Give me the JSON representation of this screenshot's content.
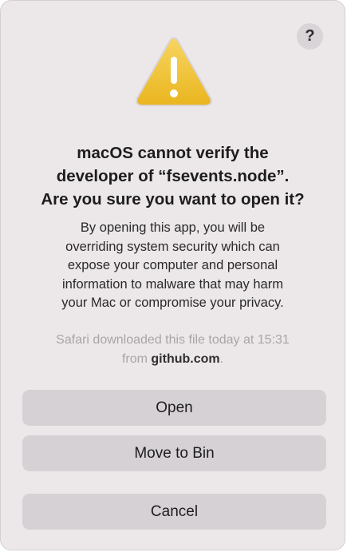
{
  "help": {
    "label": "?"
  },
  "icon": {
    "name": "warning-icon",
    "fill_color": "#f2c12e",
    "mark": "!"
  },
  "title": {
    "lines": [
      "macOS cannot verify the",
      "developer of “fsevents.node”.",
      "Are you sure you want to open it?"
    ]
  },
  "message": {
    "lines": [
      "By opening this app, you will be",
      "overriding system security which can",
      "expose your computer and personal",
      "information to malware that may harm",
      "your Mac or compromise your privacy."
    ]
  },
  "source": {
    "line1": "Safari downloaded this file today at 15:31",
    "prefix": "from ",
    "domain": "github.com",
    "suffix": "."
  },
  "buttons": {
    "open": "Open",
    "move_to_bin": "Move to Bin",
    "cancel": "Cancel"
  }
}
